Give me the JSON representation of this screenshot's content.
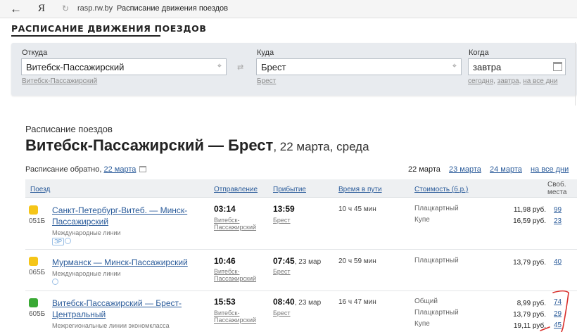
{
  "browser": {
    "url": "rasp.rw.by",
    "tab_title": "Расписание движения поездов",
    "ya": "Я",
    "back_glyph": "←",
    "reload_glyph": "↻"
  },
  "site_title": "РАСПИСАНИЕ ДВИЖЕНИЯ ПОЕЗДОВ",
  "search": {
    "from_label": "Откуда",
    "from_value": "Витебск-Пассажирский",
    "from_hint": "Витебск-Пассажирский",
    "to_label": "Куда",
    "to_value": "Брест",
    "to_hint": "Брест",
    "when_label": "Когда",
    "when_value": "завтра",
    "when_hints": [
      "сегодня",
      "завтра",
      "на все дни"
    ]
  },
  "heading": {
    "small": "Расписание поездов",
    "route": "Витебск-Пассажирский — Брест",
    "date": ", 22 марта, среда"
  },
  "return_schedule": {
    "label": "Расписание обратно,",
    "link": "22 марта"
  },
  "date_nav": [
    "22 марта",
    "23 марта",
    "24 марта",
    "на все дни"
  ],
  "table": {
    "headers": [
      "Поезд",
      "Отправление",
      "Прибытие",
      "Время в пути",
      "Стоимость (б.р.)",
      "Своб.",
      "места"
    ],
    "rows": [
      {
        "icon_color": "#f5c518",
        "number": "051Б",
        "name_line1": "Санкт-Петербург-Витеб. — Минск-",
        "name_line2": "Пассажирский",
        "type": "Международные линии",
        "badge": "ЭР",
        "dep": "03:14",
        "dep_station1": "Витебск-",
        "dep_station2": "Пассажирский",
        "arr": "13:59",
        "arr_note": "",
        "arr_station": "Брест",
        "duration": "10 ч 45 мин",
        "classes": [
          "Плацкартный",
          "Купе"
        ],
        "prices": [
          "11,98 руб.",
          "16,59 руб."
        ],
        "seats": [
          "99",
          "23"
        ]
      },
      {
        "icon_color": "#f5c518",
        "number": "065Б",
        "name_line1": "Мурманск — Минск-Пассажирский",
        "name_line2": "",
        "type": "Международные линии",
        "badge": "",
        "dep": "10:46",
        "dep_station1": "Витебск-",
        "dep_station2": "Пассажирский",
        "arr": "07:45",
        "arr_note": ", 23 мар",
        "arr_station": "Брест",
        "duration": "20 ч 59 мин",
        "classes": [
          "Плацкартный"
        ],
        "prices": [
          "13,79 руб."
        ],
        "seats": [
          "40"
        ]
      },
      {
        "icon_color": "#3aa935",
        "number": "605Б",
        "name_line1": "Витебск-Пассажирский — Брест-",
        "name_line2": "Центральный",
        "type": "Межрегиональные линии экономкласса",
        "badge": "",
        "dep": "15:53",
        "dep_station1": "Витебск-",
        "dep_station2": "Пассажирский",
        "arr": "08:40",
        "arr_note": ", 23 мар",
        "arr_station": "Брест",
        "duration": "16 ч 47 мин",
        "classes": [
          "Общий",
          "Плацкартный",
          "Купе"
        ],
        "prices": [
          "8,99 руб.",
          "13,79 руб.",
          "19,11 руб."
        ],
        "seats": [
          "74",
          "29",
          "45"
        ]
      }
    ]
  },
  "colors": {
    "link": "#2a5b9a",
    "panel": "#e8ebef",
    "annotation": "#d9302c"
  }
}
